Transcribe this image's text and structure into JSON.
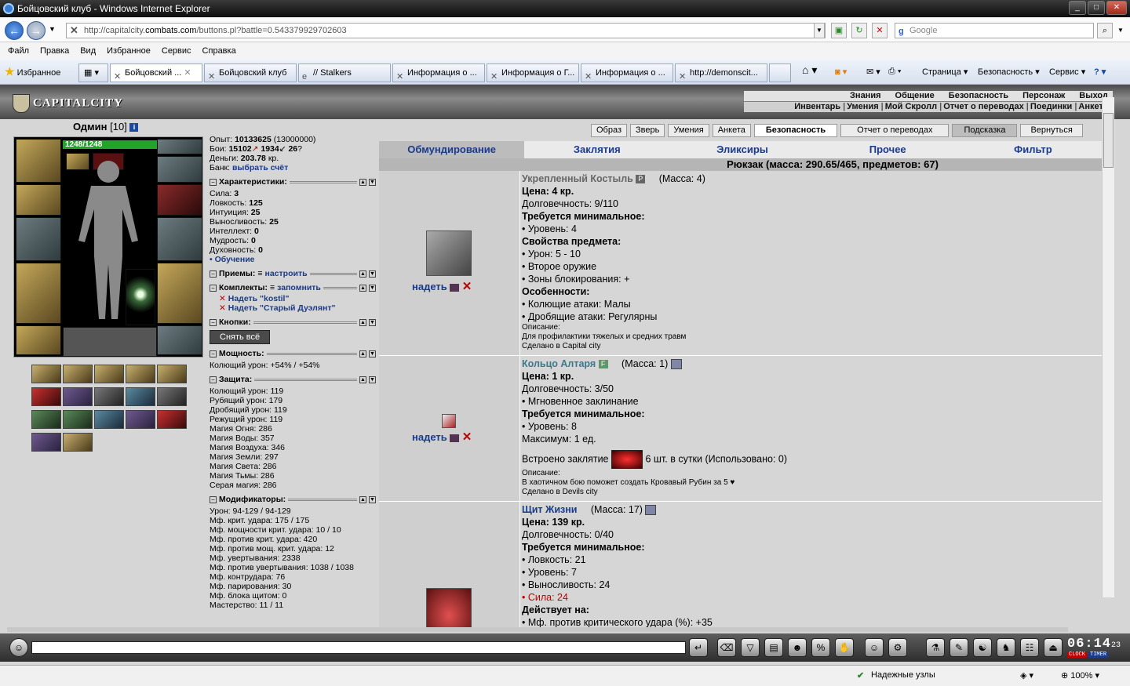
{
  "window": {
    "title": "Бойцовский клуб - Windows Internet Explorer"
  },
  "address": {
    "prefix": "http://capitalcity.",
    "domain": "combats.com",
    "suffix": "/buttons.pl?battle=0.543379929702603",
    "search_placeholder": "Google"
  },
  "menu": [
    "Файл",
    "Правка",
    "Вид",
    "Избранное",
    "Сервис",
    "Справка"
  ],
  "favorites_label": "Избранное",
  "tabs": [
    "Бойцовский ...",
    "Бойцовский клуб",
    "// Stalkers",
    "Информация о ...",
    "Информация о Г...",
    "Информация о ...",
    "http://demonscit..."
  ],
  "toolbar": {
    "page": "Страница",
    "safety": "Безопасность",
    "service": "Сервис"
  },
  "game": {
    "logo": "CAPITALCITY",
    "topmenu_row1": [
      "Знания",
      "Общение",
      "Безопасность",
      "Персонаж",
      "Выход"
    ],
    "topmenu_row2": [
      "Инвентарь",
      "Умения",
      "Мой Скролл",
      "Отчет о переводах",
      "Поединки",
      "Анкета"
    ],
    "char": {
      "name": "Одмин",
      "level": "[10]",
      "hp": "1248/1248"
    },
    "stats": {
      "exp_label": "Опыт:",
      "exp": "10133625",
      "exp_next": "(13000000)",
      "fights_label": "Бои:",
      "wins": "15102",
      "losses": "1934",
      "draws": "26",
      "money_label": "Деньги:",
      "money": "203.78",
      "money_unit": "кр.",
      "bank_label": "Банк:",
      "bank_link": "выбрать счёт",
      "chars_title": "Характеристики:",
      "chars": [
        [
          "Сила:",
          "3"
        ],
        [
          "Ловкость:",
          "125"
        ],
        [
          "Интуиция:",
          "25"
        ],
        [
          "Выносливость:",
          "25"
        ],
        [
          "Интеллект:",
          "0"
        ],
        [
          "Мудрость:",
          "0"
        ],
        [
          "Духовность:",
          "0"
        ]
      ],
      "training": "• Обучение",
      "moves_title": "Приемы:",
      "moves_link": "настроить",
      "sets_title": "Комплекты:",
      "sets_link": "запомнить",
      "set1": "Надеть \"kostil\"",
      "set2": "Надеть \"Старый Дуэлянт\"",
      "buttons_title": "Кнопки:",
      "remove_all": "Снять всё",
      "power_title": "Мощность:",
      "power": "Колющий урон: +54% / +54%",
      "defense_title": "Защита:",
      "defense": [
        "Колющий урон: 119",
        "Рубящий урон: 179",
        "Дробящий урон: 119",
        "Режущий урон: 119",
        "Магия Огня: 286",
        "Магия Воды: 357",
        "Магия Воздуха: 346",
        "Магия Земли: 297",
        "Магия Света: 286",
        "Магия Тьмы: 286",
        "Серая магия: 286"
      ],
      "mods_title": "Модификаторы:",
      "mods": [
        "Урон: 94-129 / 94-129",
        "Мф. крит. удара: 175 / 175",
        "Мф. мощности крит. удара: 10 / 10",
        "Мф. против крит. удара: 420",
        "Мф. против мощ. крит. удара: 12",
        "Мф. увертывания: 2338",
        "Мф. против увертывания: 1038 / 1038",
        "Мф. контрудара: 76",
        "Мф. парирования: 30",
        "Мф. блока щитом: 0",
        "Мастерство: 11 / 11"
      ]
    },
    "rnav": [
      "Образ",
      "Зверь",
      "Умения",
      "Анкета",
      "Безопасность",
      "Отчет о переводах",
      "Подсказка",
      "Вернуться"
    ],
    "inv_tabs": [
      "Обмундирование",
      "Заклятия",
      "Эликсиры",
      "Прочее",
      "Фильтр"
    ],
    "backpack": "Рюкзак (масса: 290.65/465, предметов: 67)",
    "wear": "надеть",
    "items": [
      {
        "name": "Укрепленный Костыль",
        "badge": "P",
        "mass": "(Масса: 4)",
        "lines": [
          [
            "b",
            "Цена: 4 кр."
          ],
          [
            "n",
            "Долговечность: 9/110"
          ],
          [
            "b",
            "Требуется минимальное:"
          ],
          [
            "n",
            "• Уровень: 4"
          ],
          [
            "b",
            "Свойства предмета:"
          ],
          [
            "n",
            "• Урон: 5 - 10"
          ],
          [
            "n",
            "• Второе оружие"
          ],
          [
            "n",
            "• Зоны блокирования: +"
          ],
          [
            "b",
            "Особенности:"
          ],
          [
            "n",
            "• Колющие атаки: Малы"
          ],
          [
            "n",
            "• Дробящие атаки: Регулярны"
          ],
          [
            "s",
            "Описание:"
          ],
          [
            "s",
            "Для профилактики тяжелых и средних травм"
          ],
          [
            "s",
            "Сделано в Capital city"
          ]
        ]
      },
      {
        "name": "Кольцо Алтаря",
        "badge": "F",
        "mass": "(Масса: 1)",
        "lines": [
          [
            "b",
            "Цена: 1 кр."
          ],
          [
            "n",
            "Долговечность: 3/50"
          ],
          [
            "n",
            "• Мгновенное заклинание"
          ],
          [
            "b",
            "Требуется минимальное:"
          ],
          [
            "n",
            "• Уровень: 8"
          ],
          [
            "n",
            "Максимум: 1 ед."
          ]
        ],
        "spell_pre": "Встроено заклятие",
        "spell_post": "6 шт. в сутки (Использовано: 0)",
        "tail": [
          [
            "s",
            "Описание:"
          ],
          [
            "s",
            "В хаотичном бою поможет создать Кровавый Рубин за 5 ♥"
          ],
          [
            "s",
            "Сделано в Devils city"
          ]
        ]
      },
      {
        "name": "Щит Жизни",
        "mass": "(Масса: 17)",
        "lines": [
          [
            "b",
            "Цена: 139 кр."
          ],
          [
            "n",
            "Долговечность: 0/40"
          ],
          [
            "b",
            "Требуется минимальное:"
          ],
          [
            "n",
            "• Ловкость: 21"
          ],
          [
            "n",
            "• Уровень: 7"
          ],
          [
            "n",
            "• Выносливость: 24"
          ],
          [
            "r",
            "• Сила: 24"
          ],
          [
            "b",
            "Действует на:"
          ],
          [
            "n",
            "• Мф. против критического удара (%): +35"
          ]
        ]
      }
    ],
    "clock": {
      "time": "06:14",
      "sec": "23",
      "clock_label": "CLOCK",
      "timer_label": "TIMER"
    }
  },
  "status": {
    "zone": "Надежные узлы",
    "zoom": "100%"
  }
}
